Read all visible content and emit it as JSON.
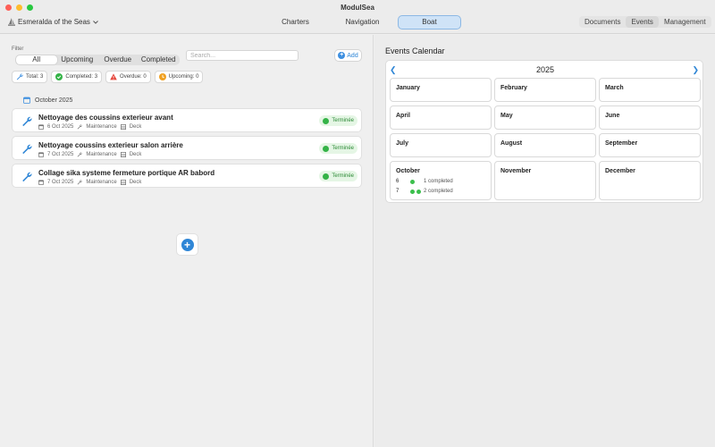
{
  "app_title": "ModulSea",
  "vessel": "Esmeralda of the Seas",
  "main_tabs": [
    "Charters",
    "Navigation",
    "Boat"
  ],
  "right_tabs": [
    "Documents",
    "Events",
    "Management"
  ],
  "filter": {
    "label": "Filter",
    "options": [
      "All",
      "Upcoming",
      "Overdue",
      "Completed"
    ],
    "selected": "All",
    "search_placeholder": "Search...",
    "add_label": "Add"
  },
  "stats": [
    {
      "label": "Total: 3",
      "icon": "wrench-icon",
      "color": "#3d8fe0"
    },
    {
      "label": "Completed: 3",
      "icon": "check-circle-icon",
      "color": "#34b347"
    },
    {
      "label": "Overdue: 0",
      "icon": "warning-icon",
      "color": "#e5443a"
    },
    {
      "label": "Upcoming: 0",
      "icon": "clock-icon",
      "color": "#f0a020"
    }
  ],
  "section_month": "October 2025",
  "events": [
    {
      "title": "Nettoyage des coussins exterieur avant",
      "date": "6 Oct 2025",
      "type": "Maintenance",
      "area": "Deck",
      "status": "Terminée"
    },
    {
      "title": "Nettoyage coussins exterieur salon arrière",
      "date": "7 Oct 2025",
      "type": "Maintenance",
      "area": "Deck",
      "status": "Terminée"
    },
    {
      "title": "Collage sika systeme fermeture portique AR babord",
      "date": "7 Oct 2025",
      "type": "Maintenance",
      "area": "Deck",
      "status": "Terminée"
    }
  ],
  "calendar": {
    "title": "Events Calendar",
    "year": "2025",
    "months": [
      "January",
      "February",
      "March",
      "April",
      "May",
      "June",
      "July",
      "August",
      "September",
      "October",
      "November",
      "December"
    ],
    "october_events": [
      {
        "day": "6",
        "dots": 1,
        "text": "1 completed"
      },
      {
        "day": "7",
        "dots": 2,
        "text": "2 completed"
      }
    ]
  },
  "colors": {
    "accent": "#2f86d6",
    "success": "#34b347",
    "success_bg": "#e5f6e5"
  }
}
